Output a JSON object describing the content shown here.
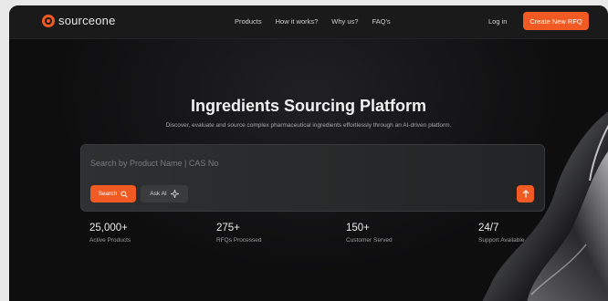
{
  "brand": {
    "name": "sourceone"
  },
  "nav": {
    "links": [
      "Products",
      "How it works?",
      "Why us?",
      "FAQ's"
    ],
    "login": "Log in",
    "cta": "Create New RFQ"
  },
  "hero": {
    "title": "Ingredients Sourcing Platform",
    "subtitle": "Discover, evaluate and source complex pharmaceutical ingredients effortlessly through an AI-driven platform."
  },
  "search": {
    "placeholder": "Search by Product Name | CAS No",
    "value": "",
    "search_label": "Search",
    "ask_label": "Ask AI"
  },
  "stats": [
    {
      "value": "25,000+",
      "label": "Active Products"
    },
    {
      "value": "275+",
      "label": "RFQs Processed"
    },
    {
      "value": "150+",
      "label": "Customer Served"
    },
    {
      "value": "24/7",
      "label": "Support Available"
    }
  ],
  "colors": {
    "accent": "#f15a22",
    "background": "#0e0e0f",
    "nav": "#1a1a1b"
  },
  "icons": {
    "search": "search-icon",
    "ai": "sparkle-icon",
    "submit": "arrow-up-icon",
    "logo": "logo-icon"
  }
}
